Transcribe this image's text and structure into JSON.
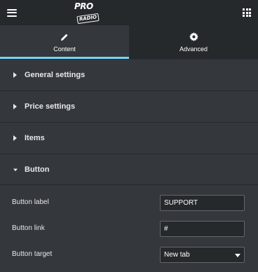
{
  "header": {
    "logo_text_top": "PRO",
    "logo_text_bottom": "RADIO",
    "menu_icon": "hamburger-icon",
    "apps_icon": "grid-icon"
  },
  "tabs": [
    {
      "label": "Content",
      "icon": "pencil-icon",
      "active": true
    },
    {
      "label": "Advanced",
      "icon": "gear-icon",
      "active": false
    }
  ],
  "sections": [
    {
      "title": "General settings",
      "expanded": false
    },
    {
      "title": "Price settings",
      "expanded": false
    },
    {
      "title": "Items",
      "expanded": false
    },
    {
      "title": "Button",
      "expanded": true
    }
  ],
  "button_panel": {
    "label_field": {
      "label": "Button label",
      "value": "SUPPORT"
    },
    "link_field": {
      "label": "Button link",
      "value": "#"
    },
    "target_field": {
      "label": "Button target",
      "value": "New tab"
    }
  },
  "colors": {
    "accent": "#71d7f7",
    "panel_bg": "#34373c",
    "dark_bg": "#26292c"
  }
}
